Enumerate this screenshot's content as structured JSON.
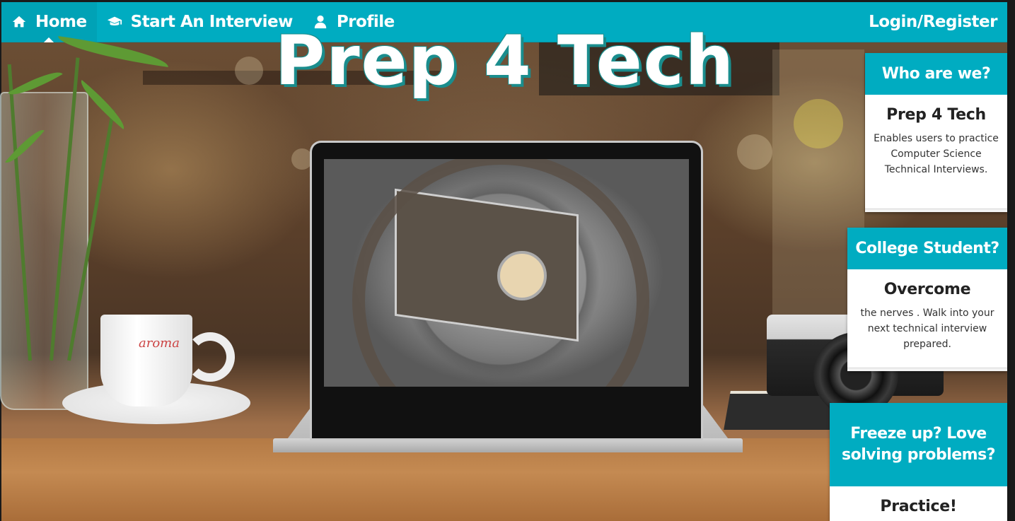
{
  "navbar": {
    "items": [
      {
        "label": "Home",
        "icon": "home-icon",
        "active": true
      },
      {
        "label": "Start An Interview",
        "icon": "graduation-cap-icon",
        "active": false
      },
      {
        "label": "Profile",
        "icon": "user-icon",
        "active": false
      }
    ],
    "login_label": "Login/Register",
    "color": "#00acc1"
  },
  "hero": {
    "title": "Prep 4 Tech",
    "cup_brand": "aroma"
  },
  "cards": [
    {
      "header": "Who are we?",
      "title": "Prep 4 Tech",
      "body": "Enables users to practice Computer Science Technical Interviews."
    },
    {
      "header": "College Student?",
      "title": "Overcome",
      "body": "the nerves . Walk into your next technical interview prepared."
    },
    {
      "header": "Freeze up? Love solving problems?",
      "title": "Practice!",
      "body": ""
    }
  ]
}
